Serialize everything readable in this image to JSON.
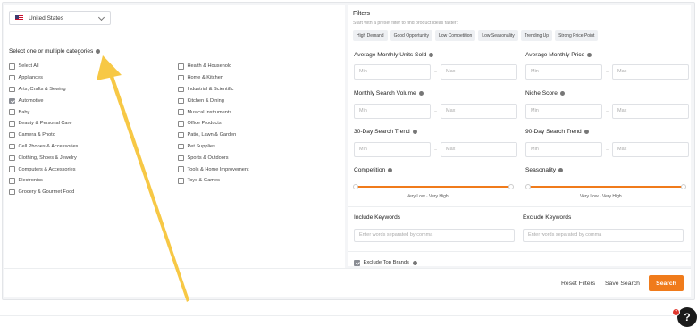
{
  "country": {
    "label": "United States",
    "flag_icon": "us-flag-icon"
  },
  "categories": {
    "heading": "Select one or multiple categories",
    "column_left": [
      {
        "label": "Select All",
        "checked": false
      },
      {
        "label": "Appliances",
        "checked": false
      },
      {
        "label": "Arts, Crafts & Sewing",
        "checked": false
      },
      {
        "label": "Automotive",
        "checked": true
      },
      {
        "label": "Baby",
        "checked": false
      },
      {
        "label": "Beauty & Personal Care",
        "checked": false
      },
      {
        "label": "Camera & Photo",
        "checked": false
      },
      {
        "label": "Cell Phones & Accessories",
        "checked": false
      },
      {
        "label": "Clothing, Shoes & Jewelry",
        "checked": false
      },
      {
        "label": "Computers & Accessories",
        "checked": false
      },
      {
        "label": "Electronics",
        "checked": false
      },
      {
        "label": "Grocery & Gourmet Food",
        "checked": false
      }
    ],
    "column_right": [
      {
        "label": "Health & Household",
        "checked": false
      },
      {
        "label": "Home & Kitchen",
        "checked": false
      },
      {
        "label": "Industrial & Scientific",
        "checked": false
      },
      {
        "label": "Kitchen & Dining",
        "checked": false
      },
      {
        "label": "Musical Instruments",
        "checked": false
      },
      {
        "label": "Office Products",
        "checked": false
      },
      {
        "label": "Patio, Lawn & Garden",
        "checked": false
      },
      {
        "label": "Pet Supplies",
        "checked": false
      },
      {
        "label": "Sports & Outdoors",
        "checked": false
      },
      {
        "label": "Tools & Home Improvement",
        "checked": false
      },
      {
        "label": "Toys & Games",
        "checked": false
      }
    ]
  },
  "filters": {
    "title": "Filters",
    "subtitle": "Start with a preset filter to find product ideas faster:",
    "presets": [
      "High Demand",
      "Good Opportunity",
      "Low Competition",
      "Low Seasonality",
      "Trending Up",
      "Strong Price Point"
    ],
    "ranges": {
      "units_sold": {
        "label": "Average Monthly Units Sold",
        "min_placeholder": "Min",
        "max_placeholder": "Max"
      },
      "price": {
        "label": "Average Monthly Price",
        "min_placeholder": "Min",
        "max_placeholder": "Max"
      },
      "search_volume": {
        "label": "Monthly Search Volume",
        "min_placeholder": "Min",
        "max_placeholder": "Max"
      },
      "niche_score": {
        "label": "Niche Score",
        "min_placeholder": "Min",
        "max_placeholder": "Max"
      },
      "search_trend": {
        "label": "30-Day Search Trend",
        "min_placeholder": "Min",
        "max_placeholder": "Max"
      },
      "search_trend_90": {
        "label": "90-Day Search Trend",
        "min_placeholder": "Min",
        "max_placeholder": "Max"
      }
    },
    "competition": {
      "label": "Competition",
      "low": "Very Low",
      "sep": "-",
      "high": "Very High"
    },
    "seasonality": {
      "label": "Seasonality",
      "low": "Very Low",
      "sep": "-",
      "high": "Very High"
    },
    "include_keywords": {
      "label": "Include Keywords",
      "placeholder": "Enter words separated by comma"
    },
    "exclude_keywords": {
      "label": "Exclude Keywords",
      "placeholder": "Enter words separated by comma"
    },
    "exclude_brands": {
      "label": "Exclude Top Brands",
      "checked": true
    }
  },
  "actions": {
    "reset": "Reset Filters",
    "save": "Save Search",
    "search": "Search"
  },
  "help": {
    "badge": "7",
    "glyph": "?"
  },
  "colors": {
    "accent": "#f07b1b",
    "arrow": "#f7c845"
  }
}
